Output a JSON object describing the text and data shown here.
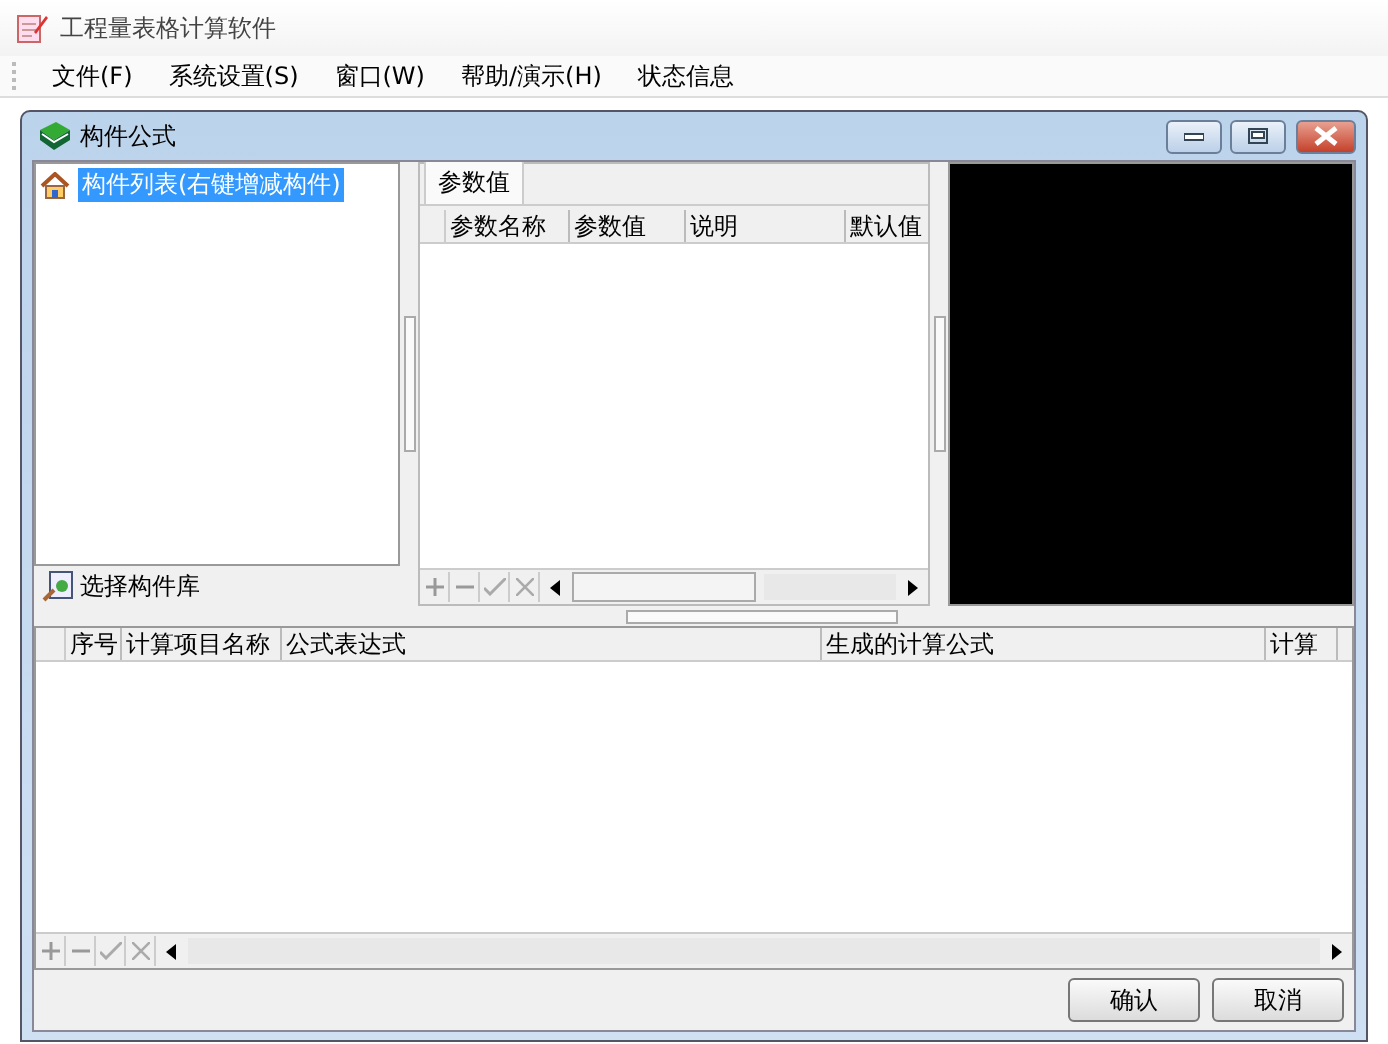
{
  "app": {
    "title": "工程量表格计算软件"
  },
  "menu": [
    {
      "label": "文件(F)"
    },
    {
      "label": "系统设置(S)"
    },
    {
      "label": "窗口(W)"
    },
    {
      "label": "帮助/演示(H)"
    },
    {
      "label": "状态信息"
    }
  ],
  "child_window": {
    "title": "构件公式"
  },
  "tree": [
    {
      "label": "构件列表(右键增减构件)",
      "selected": true
    }
  ],
  "library_button": "选择构件库",
  "param_tabs": [
    {
      "label": "参数值",
      "selected": true
    }
  ],
  "param_columns": [
    "参数名称",
    "参数值",
    "说明",
    "默认值"
  ],
  "formula_columns": [
    "序号",
    "计算项目名称",
    "公式表达式",
    "生成的计算公式",
    "计算"
  ],
  "buttons": [
    "确认",
    "取消"
  ]
}
